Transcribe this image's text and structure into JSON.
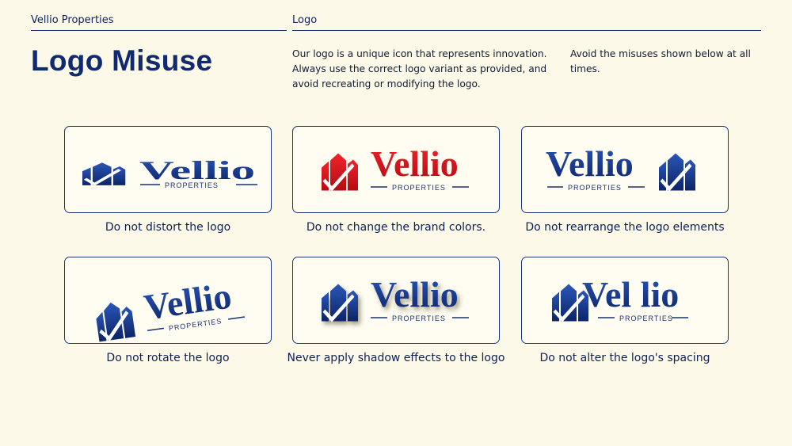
{
  "header": {
    "left_label": "Vellio Properties",
    "right_label": "Logo"
  },
  "title": "Logo Misuse",
  "intro": {
    "paragraph_1": "Our logo is a unique icon that represents innovation. Always use the correct logo variant as provided, and avoid recreating or modifying the logo.",
    "paragraph_2": "Avoid the misuses shown below at all times."
  },
  "brand": {
    "wordmark": "Vellio",
    "subline": "PROPERTIES",
    "primary_color": "#17388f",
    "misuse_red_color": "#d8121b"
  },
  "misuses": [
    {
      "caption": "Do not distort the logo",
      "wordmark": "Vellio",
      "subline": "PROPERTIES"
    },
    {
      "caption": "Do not change the brand colors.",
      "wordmark": "Vellio",
      "subline": "PROPERTIES"
    },
    {
      "caption": "Do not rearrange the logo elements",
      "wordmark": "Vellio",
      "subline": "PROPERTIES"
    },
    {
      "caption": "Do not rotate the logo",
      "wordmark": "Vellio",
      "subline": "PROPERTIES"
    },
    {
      "caption": "Never apply shadow effects to the logo",
      "wordmark": "Vellio",
      "subline": "PROPERTIES"
    },
    {
      "caption": "Do not alter the logo's spacing",
      "wordmark": "Vel lio",
      "subline": "PROPERTIES"
    }
  ]
}
